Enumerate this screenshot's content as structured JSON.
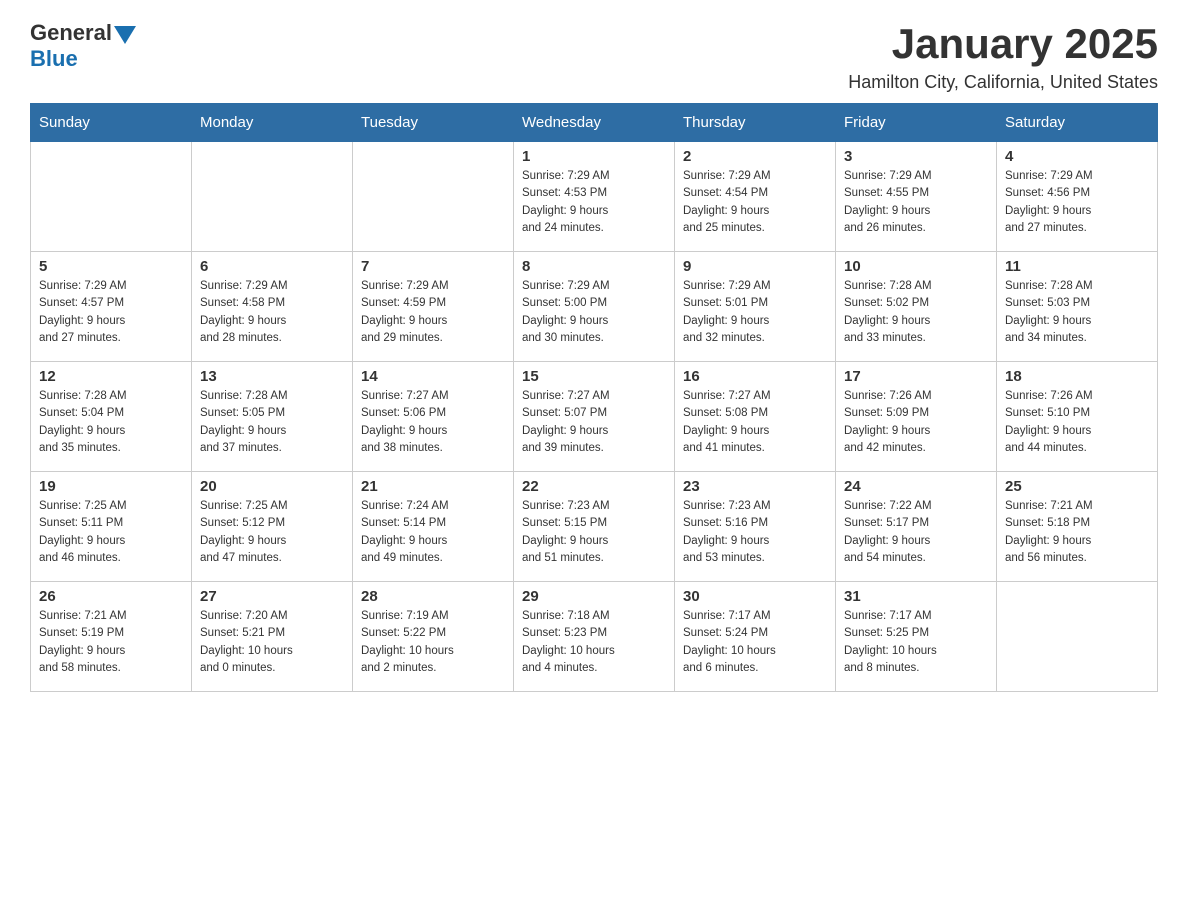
{
  "header": {
    "logo": {
      "text_general": "General",
      "text_blue": "Blue"
    },
    "title": "January 2025",
    "subtitle": "Hamilton City, California, United States"
  },
  "calendar": {
    "days_of_week": [
      "Sunday",
      "Monday",
      "Tuesday",
      "Wednesday",
      "Thursday",
      "Friday",
      "Saturday"
    ],
    "weeks": [
      [
        {
          "day": "",
          "info": ""
        },
        {
          "day": "",
          "info": ""
        },
        {
          "day": "",
          "info": ""
        },
        {
          "day": "1",
          "info": "Sunrise: 7:29 AM\nSunset: 4:53 PM\nDaylight: 9 hours\nand 24 minutes."
        },
        {
          "day": "2",
          "info": "Sunrise: 7:29 AM\nSunset: 4:54 PM\nDaylight: 9 hours\nand 25 minutes."
        },
        {
          "day": "3",
          "info": "Sunrise: 7:29 AM\nSunset: 4:55 PM\nDaylight: 9 hours\nand 26 minutes."
        },
        {
          "day": "4",
          "info": "Sunrise: 7:29 AM\nSunset: 4:56 PM\nDaylight: 9 hours\nand 27 minutes."
        }
      ],
      [
        {
          "day": "5",
          "info": "Sunrise: 7:29 AM\nSunset: 4:57 PM\nDaylight: 9 hours\nand 27 minutes."
        },
        {
          "day": "6",
          "info": "Sunrise: 7:29 AM\nSunset: 4:58 PM\nDaylight: 9 hours\nand 28 minutes."
        },
        {
          "day": "7",
          "info": "Sunrise: 7:29 AM\nSunset: 4:59 PM\nDaylight: 9 hours\nand 29 minutes."
        },
        {
          "day": "8",
          "info": "Sunrise: 7:29 AM\nSunset: 5:00 PM\nDaylight: 9 hours\nand 30 minutes."
        },
        {
          "day": "9",
          "info": "Sunrise: 7:29 AM\nSunset: 5:01 PM\nDaylight: 9 hours\nand 32 minutes."
        },
        {
          "day": "10",
          "info": "Sunrise: 7:28 AM\nSunset: 5:02 PM\nDaylight: 9 hours\nand 33 minutes."
        },
        {
          "day": "11",
          "info": "Sunrise: 7:28 AM\nSunset: 5:03 PM\nDaylight: 9 hours\nand 34 minutes."
        }
      ],
      [
        {
          "day": "12",
          "info": "Sunrise: 7:28 AM\nSunset: 5:04 PM\nDaylight: 9 hours\nand 35 minutes."
        },
        {
          "day": "13",
          "info": "Sunrise: 7:28 AM\nSunset: 5:05 PM\nDaylight: 9 hours\nand 37 minutes."
        },
        {
          "day": "14",
          "info": "Sunrise: 7:27 AM\nSunset: 5:06 PM\nDaylight: 9 hours\nand 38 minutes."
        },
        {
          "day": "15",
          "info": "Sunrise: 7:27 AM\nSunset: 5:07 PM\nDaylight: 9 hours\nand 39 minutes."
        },
        {
          "day": "16",
          "info": "Sunrise: 7:27 AM\nSunset: 5:08 PM\nDaylight: 9 hours\nand 41 minutes."
        },
        {
          "day": "17",
          "info": "Sunrise: 7:26 AM\nSunset: 5:09 PM\nDaylight: 9 hours\nand 42 minutes."
        },
        {
          "day": "18",
          "info": "Sunrise: 7:26 AM\nSunset: 5:10 PM\nDaylight: 9 hours\nand 44 minutes."
        }
      ],
      [
        {
          "day": "19",
          "info": "Sunrise: 7:25 AM\nSunset: 5:11 PM\nDaylight: 9 hours\nand 46 minutes."
        },
        {
          "day": "20",
          "info": "Sunrise: 7:25 AM\nSunset: 5:12 PM\nDaylight: 9 hours\nand 47 minutes."
        },
        {
          "day": "21",
          "info": "Sunrise: 7:24 AM\nSunset: 5:14 PM\nDaylight: 9 hours\nand 49 minutes."
        },
        {
          "day": "22",
          "info": "Sunrise: 7:23 AM\nSunset: 5:15 PM\nDaylight: 9 hours\nand 51 minutes."
        },
        {
          "day": "23",
          "info": "Sunrise: 7:23 AM\nSunset: 5:16 PM\nDaylight: 9 hours\nand 53 minutes."
        },
        {
          "day": "24",
          "info": "Sunrise: 7:22 AM\nSunset: 5:17 PM\nDaylight: 9 hours\nand 54 minutes."
        },
        {
          "day": "25",
          "info": "Sunrise: 7:21 AM\nSunset: 5:18 PM\nDaylight: 9 hours\nand 56 minutes."
        }
      ],
      [
        {
          "day": "26",
          "info": "Sunrise: 7:21 AM\nSunset: 5:19 PM\nDaylight: 9 hours\nand 58 minutes."
        },
        {
          "day": "27",
          "info": "Sunrise: 7:20 AM\nSunset: 5:21 PM\nDaylight: 10 hours\nand 0 minutes."
        },
        {
          "day": "28",
          "info": "Sunrise: 7:19 AM\nSunset: 5:22 PM\nDaylight: 10 hours\nand 2 minutes."
        },
        {
          "day": "29",
          "info": "Sunrise: 7:18 AM\nSunset: 5:23 PM\nDaylight: 10 hours\nand 4 minutes."
        },
        {
          "day": "30",
          "info": "Sunrise: 7:17 AM\nSunset: 5:24 PM\nDaylight: 10 hours\nand 6 minutes."
        },
        {
          "day": "31",
          "info": "Sunrise: 7:17 AM\nSunset: 5:25 PM\nDaylight: 10 hours\nand 8 minutes."
        },
        {
          "day": "",
          "info": ""
        }
      ]
    ]
  }
}
